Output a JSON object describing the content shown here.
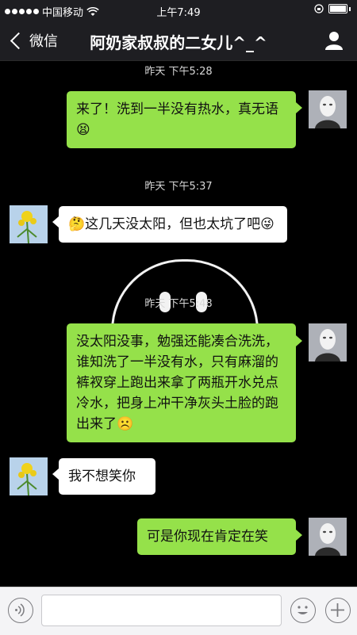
{
  "status_bar": {
    "carrier": "中国移动",
    "time": "上午7:49"
  },
  "nav": {
    "back_label": "微信",
    "title": "阿奶家叔叔的二女儿^_^"
  },
  "messages": [
    {
      "type": "timestamp",
      "text": "昨天 下午5:28"
    },
    {
      "type": "sent",
      "text": "来了！洗到一半没有热水，真无语😫"
    },
    {
      "type": "timestamp",
      "text": "昨天 下午5:37"
    },
    {
      "type": "received",
      "text": "🤔这几天没太阳，但也太坑了吧😜"
    },
    {
      "type": "timestamp",
      "text": "昨天 下午5:48"
    },
    {
      "type": "sent",
      "text": "没太阳没事，勉强还能凑合洗洗，谁知洗了一半没有水，只有麻溜的裤衩穿上跑出来拿了两瓶开水兑点冷水，把身上冲干净灰头土脸的跑出来了☹️"
    },
    {
      "type": "received",
      "text": "我不想笑你"
    },
    {
      "type": "sent",
      "text": "可是你现在肯定在笑"
    }
  ],
  "input_bar": {
    "placeholder": ""
  },
  "icons": {
    "voice": "voice-icon",
    "emoji": "emoji-icon",
    "add": "add-icon",
    "profile": "person-icon",
    "back": "chevron-left-icon"
  },
  "colors": {
    "sent_bubble": "#95e14a",
    "received_bubble": "#ffffff",
    "background": "#000000"
  }
}
